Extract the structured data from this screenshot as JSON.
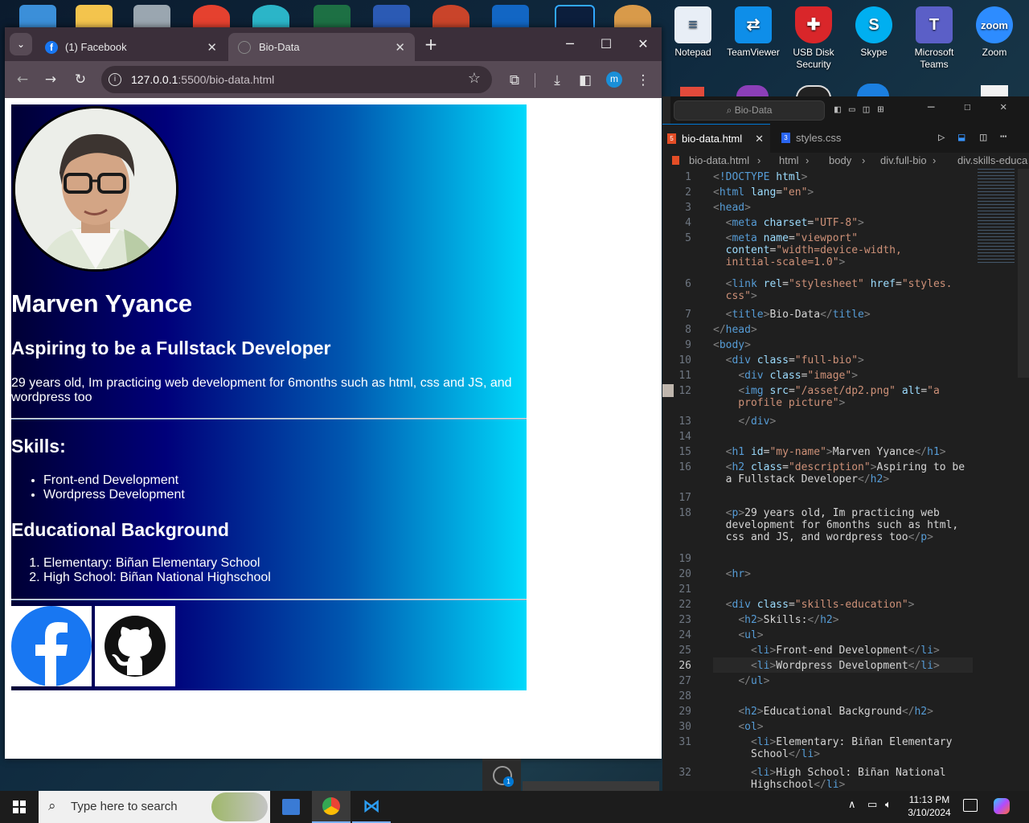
{
  "desktop": {
    "icons": [
      {
        "label": "Notepad",
        "color": "#e8eef6"
      },
      {
        "label": "TeamViewer",
        "color": "#0e8ee9"
      },
      {
        "label": "USB Disk Security",
        "color": "#d9262a"
      },
      {
        "label": "Skype",
        "color": "#00aff0"
      },
      {
        "label": "Microsoft Teams",
        "color": "#5b5fc7"
      },
      {
        "label": "Zoom",
        "color": "#2d8cff"
      }
    ]
  },
  "chrome": {
    "tabs": [
      {
        "label": "(1) Facebook"
      },
      {
        "label": "Bio-Data"
      }
    ],
    "url_host": "127.0.0.1",
    "url_rest": ":5500/bio-data.html",
    "profile_initial": "m"
  },
  "bio": {
    "name": "Marven Yyance",
    "description": "Aspiring to be a Fullstack Developer",
    "paragraph": "29 years old, Im practicing web development for 6months such as html, css and JS, and wordpress too",
    "skills_heading": "Skills:",
    "skills": [
      "Front-end Development",
      "Wordpress Development"
    ],
    "education_heading": "Educational Background",
    "education": [
      "Elementary: Biñan Elementary School",
      "High School: Biñan National Highschool"
    ]
  },
  "vscode": {
    "search": "Bio-Data",
    "tabs": [
      {
        "label": "bio-data.html"
      },
      {
        "label": "styles.css"
      }
    ],
    "breadcrumb": [
      "bio-data.html",
      "html",
      "body",
      "div.full-bio",
      "div.skills-educa"
    ]
  },
  "taskbar": {
    "search_placeholder": "Type here to search",
    "time": "11:13 PM",
    "date": "3/10/2024"
  }
}
